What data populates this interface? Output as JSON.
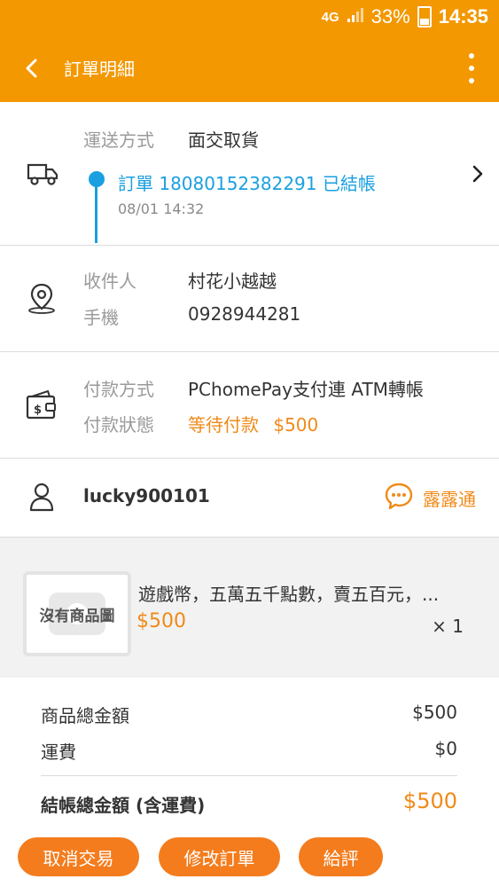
{
  "status_bar": {
    "network": "4G",
    "signal_label": "1",
    "battery": "33%",
    "time": "14:35"
  },
  "app_bar": {
    "title": "訂單明細",
    "back_icon": "back-arrow-icon",
    "more_icon": "more-vertical-icon"
  },
  "shipping": {
    "icon": "truck-icon",
    "label": "運送方式",
    "value": "面交取貨",
    "order_status": "訂單 18080152382291 已結帳",
    "order_time": "08/01 14:32",
    "accent_color": "#1aa0e0"
  },
  "receiver": {
    "icon": "location-pin-icon",
    "name_label": "收件人",
    "name": "村花小越越",
    "phone_label": "手機",
    "phone": "0928944281"
  },
  "payment": {
    "icon": "wallet-icon",
    "method_label": "付款方式",
    "method": "PChomePay支付連 ATM轉帳",
    "status_label": "付款狀態",
    "status": "等待付款",
    "status_amount": "$500"
  },
  "seller": {
    "icon": "user-icon",
    "username": "lucky900101",
    "chat_icon": "chat-bubble-icon",
    "chat_label": "露露通"
  },
  "product": {
    "image_placeholder": "沒有商品圖",
    "name": "遊戲幣，五萬五千點數，賣五百元，...",
    "price": "$500",
    "quantity": "× 1"
  },
  "summary": {
    "subtotal_label": "商品總金額",
    "subtotal": "$500",
    "shipping_label": "運費",
    "shipping": "$0",
    "total_label": "結帳總金額 (含運費)",
    "total": "$500"
  },
  "actions": {
    "cancel": "取消交易",
    "modify": "修改訂單",
    "review": "給評"
  },
  "colors": {
    "brand": "#f39800",
    "accent_orange": "#f08a18",
    "button": "#f47c1d"
  }
}
